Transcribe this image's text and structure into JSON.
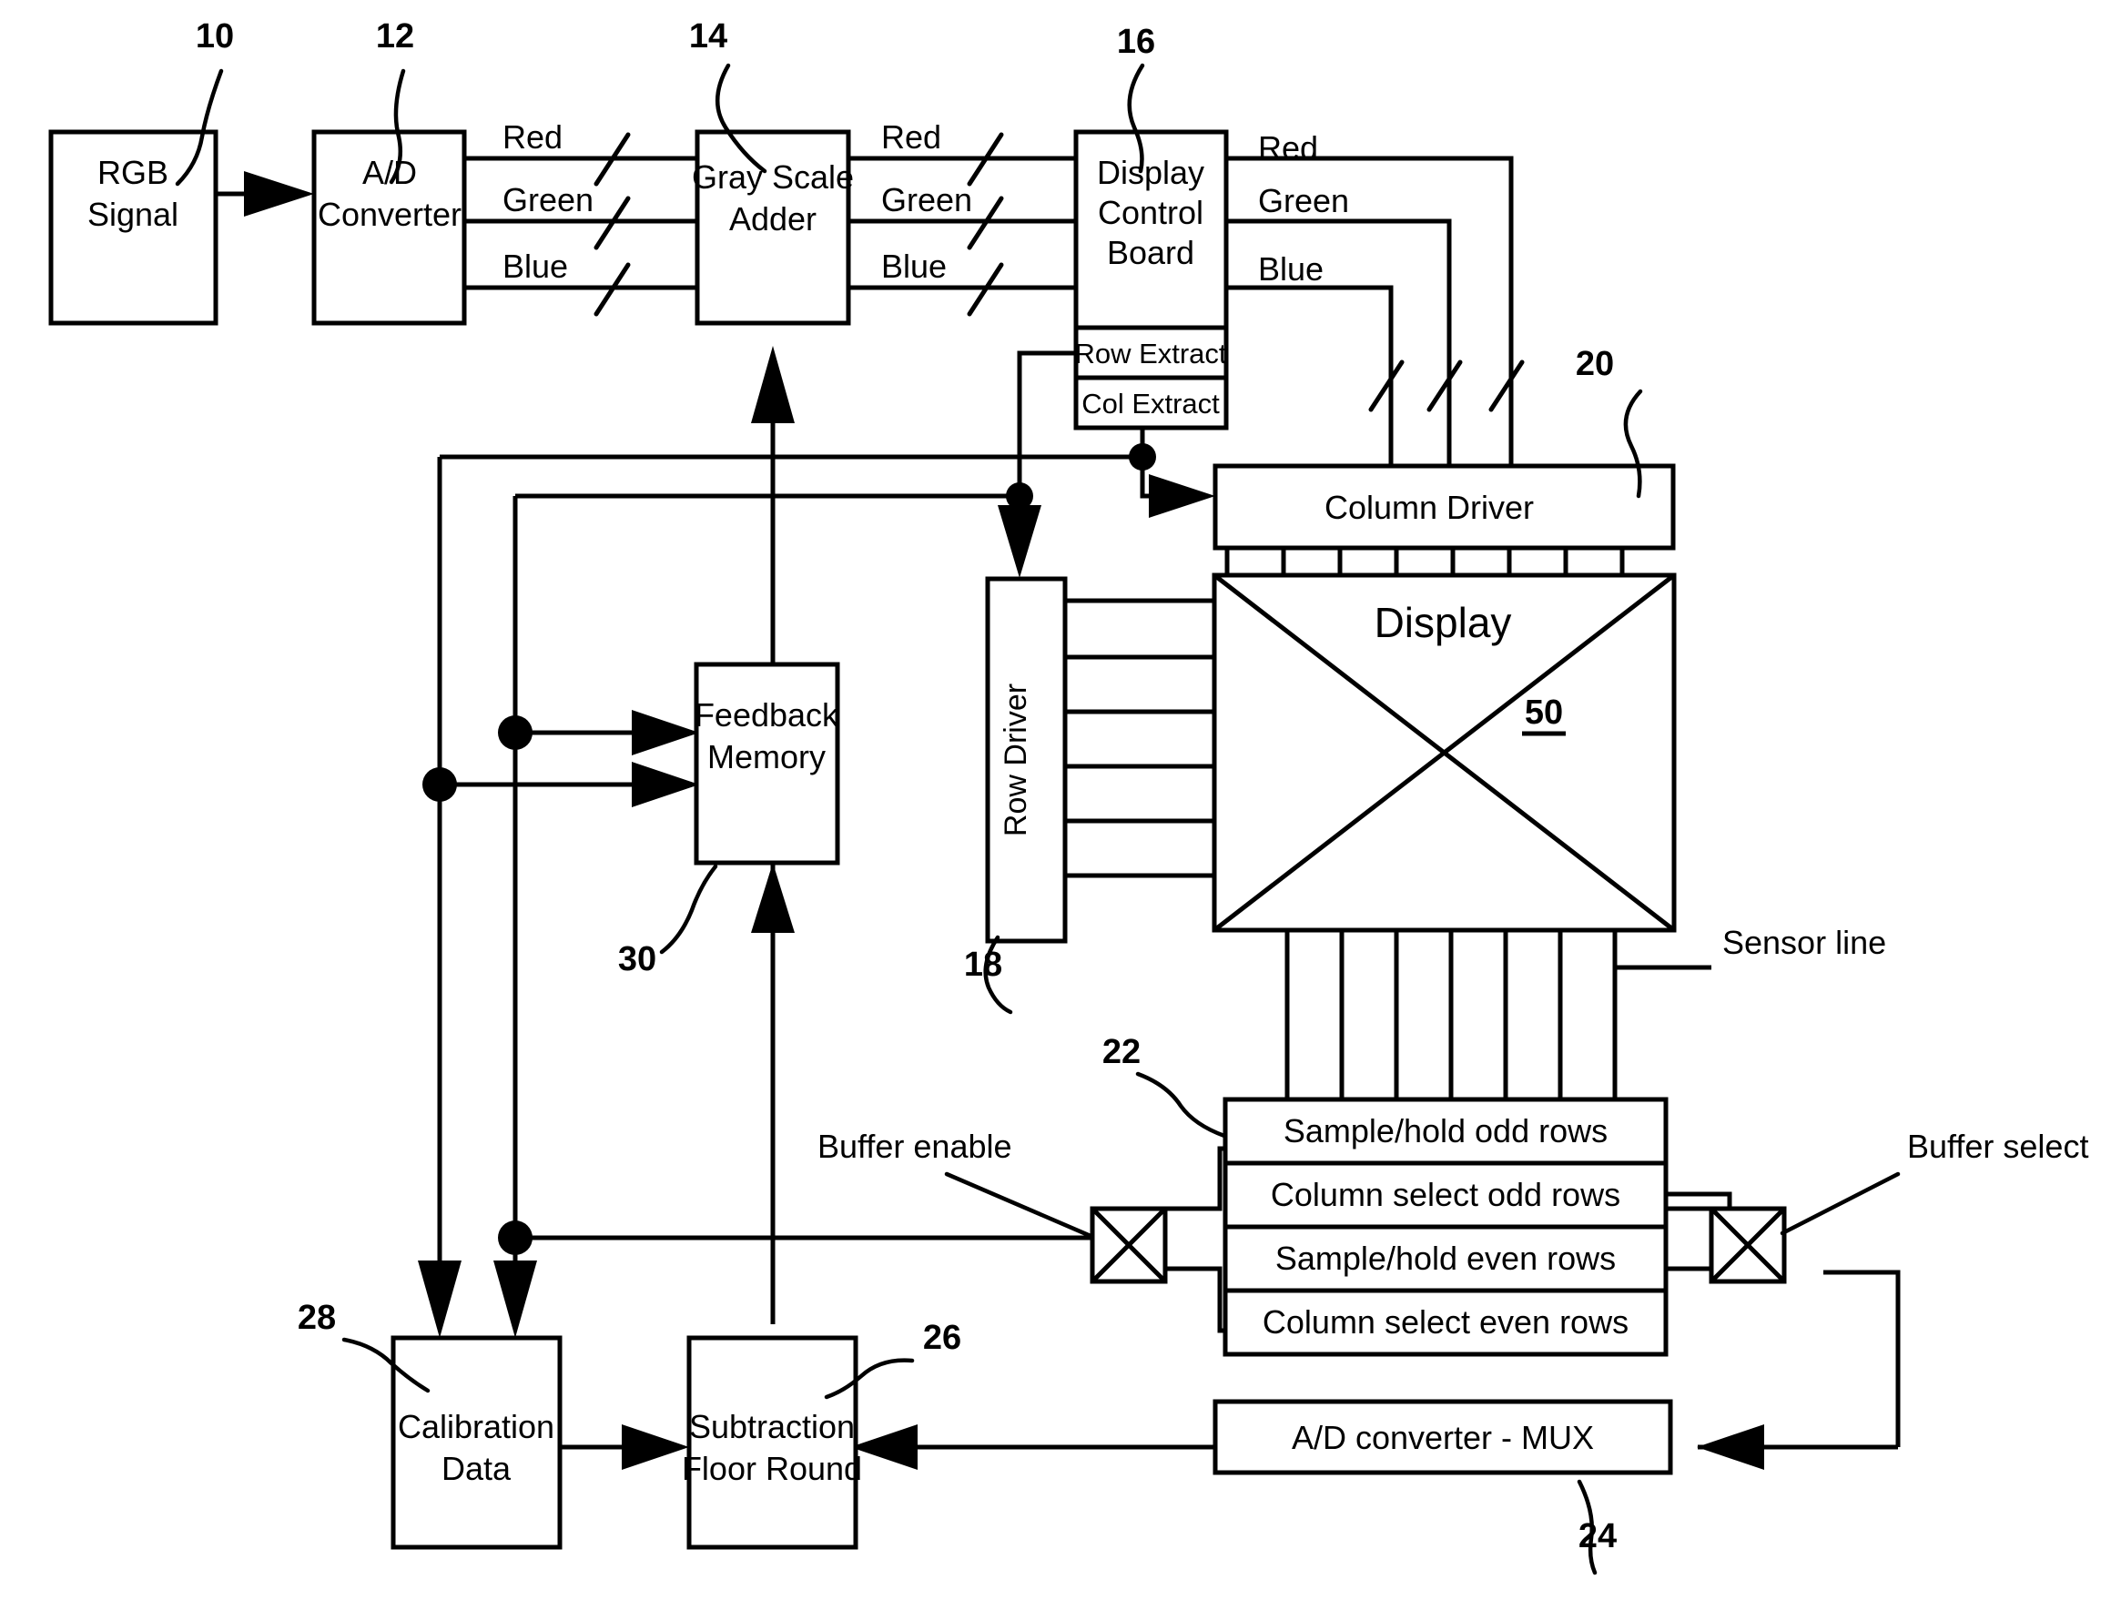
{
  "figure": {
    "type": "patent-block-diagram",
    "title": "Display feedback calibration block diagram"
  },
  "blocks": {
    "rgb_signal": {
      "label_line1": "RGB",
      "label_line2": "Signal",
      "ref": "10"
    },
    "ad_converter": {
      "label_line1": "A/D",
      "label_line2": "Converter",
      "ref": "12"
    },
    "gray_scale_adder": {
      "label_line1": "Gray Scale",
      "label_line2": "Adder",
      "ref": "14"
    },
    "display_control_board": {
      "label_line1": "Display",
      "label_line2": "Control",
      "label_line3": "Board",
      "ref": "16"
    },
    "row_extract": {
      "label": "Row Extract"
    },
    "col_extract": {
      "label": "Col Extract"
    },
    "column_driver": {
      "label": "Column Driver",
      "ref": "20"
    },
    "row_driver": {
      "label": "Row Driver",
      "ref": "18"
    },
    "display": {
      "label": "Display",
      "ref": "50"
    },
    "feedback_memory": {
      "label_line1": "Feedback",
      "label_line2": "Memory",
      "ref": "30"
    },
    "sample_hold_stack": {
      "ref": "22",
      "rows": [
        "Sample/hold odd rows",
        "Column select odd rows",
        "Sample/hold even rows",
        "Column select even rows"
      ]
    },
    "ad_converter_mux": {
      "label": "A/D converter - MUX",
      "ref": "24"
    },
    "calibration_data": {
      "label_line1": "Calibration",
      "label_line2": "Data",
      "ref": "28"
    },
    "subtraction_floor_round": {
      "label_line1": "Subtraction",
      "label_line2": "Floor Round",
      "ref": "26"
    }
  },
  "signal_labels": {
    "ad_out": [
      "Red",
      "Green",
      "Blue"
    ],
    "gsa_out": [
      "Red",
      "Green",
      "Blue"
    ],
    "dcb_out": [
      "Red",
      "Green",
      "Blue"
    ]
  },
  "annotations": {
    "sensor_line": "Sensor line",
    "buffer_enable": "Buffer enable",
    "buffer_select": "Buffer select"
  },
  "reference_numerals": [
    "10",
    "12",
    "14",
    "16",
    "18",
    "20",
    "22",
    "24",
    "26",
    "28",
    "30",
    "50"
  ],
  "colors": {
    "ink": "#000000",
    "paper": "#ffffff"
  }
}
